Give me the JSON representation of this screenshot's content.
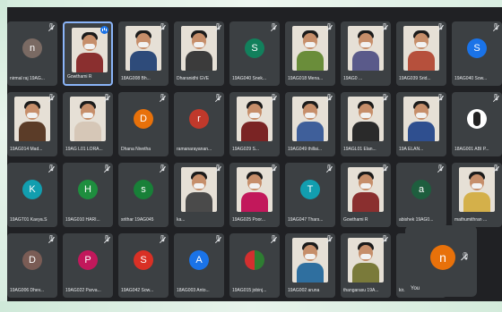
{
  "tiles": [
    {
      "name": "nirmal raj 19AG...",
      "type": "avatar",
      "letter": "n",
      "color": "#7a6a63",
      "mic": "off"
    },
    {
      "name": "Gowthami R",
      "type": "photo",
      "shirt": "#8a2f2f",
      "speaking": true,
      "mic": "speaking"
    },
    {
      "name": "18AG008 Bh...",
      "type": "photo",
      "shirt": "#2e4b7a",
      "mic": "off"
    },
    {
      "name": "Dharanidhi GVE",
      "type": "photo",
      "shirt": "#3b3b3b",
      "mic": "off"
    },
    {
      "name": "19AG040 Snek...",
      "type": "avatar",
      "letter": "S",
      "color": "#12805c",
      "mic": "off"
    },
    {
      "name": "19AG018 Mena...",
      "type": "photo",
      "shirt": "#6a8d3a",
      "mic": "off"
    },
    {
      "name": "19AG0 ...",
      "type": "photo",
      "shirt": "#5a5a8a",
      "mic": "off"
    },
    {
      "name": "19AG039 Srid...",
      "type": "photo",
      "shirt": "#b6503c",
      "mic": "off"
    },
    {
      "name": "19AG040 Sow...",
      "type": "avatar",
      "letter": "S",
      "color": "#1a73e8",
      "mic": "off"
    },
    {
      "name": "19AG014 Mad...",
      "type": "photo",
      "shirt": "#5b3c28",
      "mic": "off"
    },
    {
      "name": "19AG L01 LORA...",
      "type": "photo",
      "shirt": "#d6c7b7",
      "mic": "off"
    },
    {
      "name": "Dhana Nivetha",
      "type": "avatar",
      "letter": "D",
      "color": "#e8710a",
      "mic": "off"
    },
    {
      "name": "ramanarayanan...",
      "type": "avatar",
      "letter": "r",
      "color": "#c0392b",
      "mic": "off"
    },
    {
      "name": "19AG029 S...",
      "type": "photo",
      "shirt": "#7a2424",
      "mic": "off"
    },
    {
      "name": "19AG049 thillai...",
      "type": "photo",
      "shirt": "#3f5f9a",
      "mic": "off"
    },
    {
      "name": "19AGL01 Elan...",
      "type": "photo",
      "shirt": "#2a2a2a",
      "mic": "off"
    },
    {
      "name": "19A  ELAN...",
      "type": "photo",
      "shirt": "#2f4f8f",
      "mic": "off"
    },
    {
      "name": "18AG001 ABI P...",
      "type": "logo",
      "mic": "off"
    },
    {
      "name": "19AGT01 Kavya.S",
      "type": "avatar",
      "letter": "K",
      "color": "#129eaf",
      "mic": "off"
    },
    {
      "name": "19AG010 HARI...",
      "type": "avatar",
      "letter": "H",
      "color": "#1e8e3e",
      "mic": "off"
    },
    {
      "name": "srithar 19AG045",
      "type": "avatar",
      "letter": "s",
      "color": "#188038",
      "mic": "off"
    },
    {
      "name": "ka...",
      "type": "photo",
      "shirt": "#4a4a4a",
      "mic": "off"
    },
    {
      "name": "19AG025 Poor...",
      "type": "photo",
      "shirt": "#c2185b",
      "mic": "off"
    },
    {
      "name": "19AG047 Thars...",
      "type": "avatar",
      "letter": "T",
      "color": "#129eaf",
      "mic": "off"
    },
    {
      "name": "Gowthami R",
      "type": "photo",
      "shirt": "#8a2f2f",
      "mic": "off"
    },
    {
      "name": "abishek 19AG0...",
      "type": "avatar",
      "letter": "a",
      "color": "#1e5e3e",
      "mic": "off"
    },
    {
      "name": "mathumithran ...",
      "type": "photo",
      "shirt": "#d4b04a",
      "mic": "off"
    },
    {
      "name": "19AG006 Dhev...",
      "type": "avatar",
      "letter": "D",
      "color": "#7a5c55",
      "mic": "off"
    },
    {
      "name": "19AG022 Parva...",
      "type": "avatar",
      "letter": "P",
      "color": "#c2185b",
      "mic": "off"
    },
    {
      "name": "19AG042 Sow...",
      "type": "avatar",
      "letter": "S",
      "color": "#d93025",
      "mic": "off"
    },
    {
      "name": "18AG003 Anto...",
      "type": "avatar",
      "letter": "A",
      "color": "#1a73e8",
      "mic": "off"
    },
    {
      "name": "19AG015 jobinj...",
      "type": "redgreen",
      "mic": "off"
    },
    {
      "name": "19AG002 aruna",
      "type": "photo",
      "shirt": "#2f6f9f",
      "mic": "off"
    },
    {
      "name": "thangarasu 19A...",
      "type": "photo",
      "shirt": "#7a7a3a",
      "mic": "off"
    },
    {
      "name": "kir...",
      "type": "avatar",
      "letter": "",
      "color": "#3c4043",
      "mic": "off"
    }
  ],
  "self": {
    "name": "You",
    "letter": "n",
    "color": "#e8710a",
    "mic": "off"
  }
}
